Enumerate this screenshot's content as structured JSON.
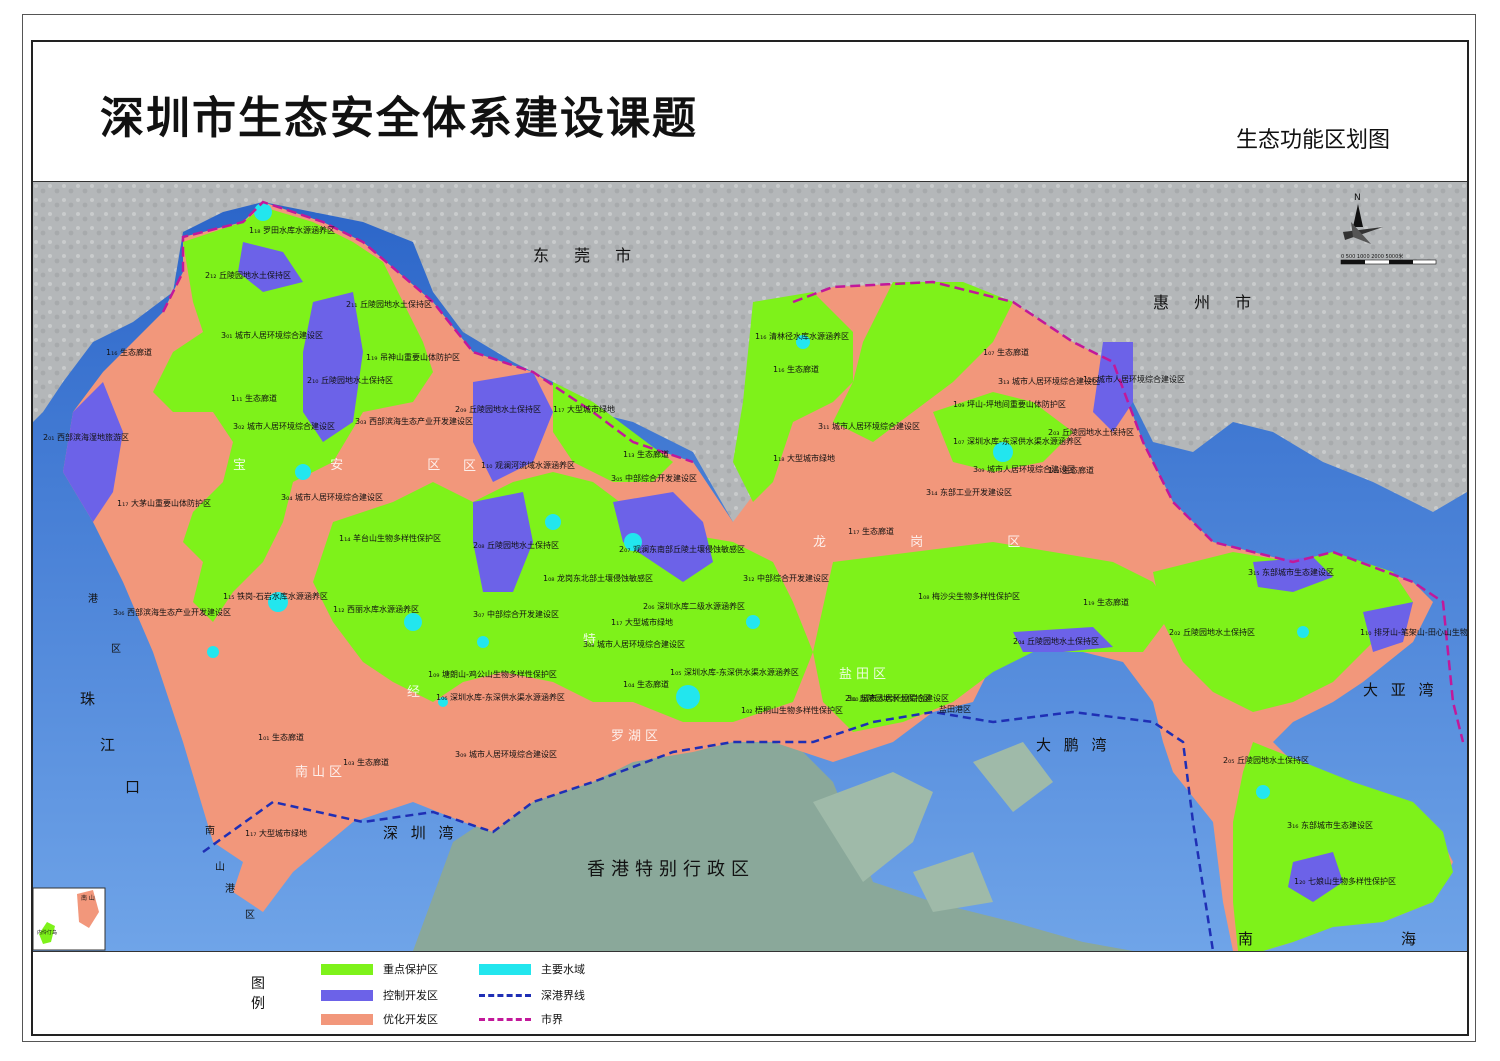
{
  "title": "深圳市生态安全体系建设课题",
  "subtitle": "生态功能区划图",
  "colors": {
    "key_protection": "#7ef21a",
    "controlled_development": "#6c62e8",
    "optimized_development": "#f2977b",
    "water": "#22e6ee",
    "sea": "#3d7fe0",
    "land_gray": "#b9bcbd",
    "hk_land": "#8aa89a",
    "sz_hk_boundary": "#1f2fb5",
    "city_boundary": "#c2189a"
  },
  "north_arrow": {
    "label": "N",
    "scale_label": "0  500  1000  2000    5000米"
  },
  "places": {
    "dongguan": "东 莞 市",
    "huizhou": "惠 州 市",
    "hongkong": "香港特别行政区",
    "shenzhen_bay": "深 圳 湾",
    "dapeng_bay": "大 鹏 湾",
    "daya_bay": "大 亚 湾",
    "south_sea_1": "南",
    "south_sea_2": "海",
    "pearl_river_mouth": [
      "珠",
      "江",
      "口"
    ],
    "nanshan_port": [
      "南",
      "山",
      "港",
      "区"
    ],
    "port_west": "港",
    "port_west_2": "区",
    "yantian_port": "盐田港区"
  },
  "districts": {
    "baoan": "宝  安  区",
    "longgang": "龙  岗  区",
    "nanshan": "南山区",
    "futian": "经",
    "futian2": "特",
    "futian3": "区",
    "luohu": "罗湖区",
    "yantian": "盐田区"
  },
  "zones": [
    "1₁₈ 罗田水库水源涵养区",
    "2₁₂ 丘陵园地水土保持区",
    "2₁₁ 丘陵园地水土保持区",
    "3₀₁ 城市人居环境综合建设区",
    "1₁₆ 生态廊道",
    "1₁₉ 吊神山重要山体防护区",
    "2₁₀ 丘陵园地水土保持区",
    "1₁₁ 生态廊道",
    "3₀₂ 城市人居环境综合建设区",
    "3₀₃ 西部滨海生态产业开发建设区",
    "2₀₁ 西部滨海湿地旅游区",
    "2₀₉ 丘陵园地水土保持区",
    "1₁₇ 大型城市绿地",
    "1₁₀ 观澜河流域水源涵养区",
    "1₁₃ 生态廊道",
    "1₁₇ 大茅山重要山体防护区",
    "3₀₄ 城市人居环境综合建设区",
    "1₁₄ 羊台山生物多样性保护区",
    "2₀₈ 丘陵园地水土保持区",
    "2₀₇ 观澜东南部丘陵土壤侵蚀敏感区",
    "3₀₅ 中部综合开发建设区",
    "1₀₈ 龙岗东北部土壤侵蚀敏感区",
    "1₁₅ 铁岗-石岩水库水源涵养区",
    "1₁₂ 西丽水库水源涵养区",
    "3₀₆ 西部滨海生态产业开发建设区",
    "3₀₇ 中部综合开发建设区",
    "1₁₇ 大型城市绿地",
    "2₀₆ 深圳水库二级水源涵养区",
    "3₀₈ 城市人居环境综合建设区",
    "1₀₉ 塘朗山-鸡公山生物多样性保护区",
    "1₀₆ 深圳水库-东深供水渠水源涵养区",
    "1₀₅ 深圳水库-东深供水渠水源涵养区",
    "1₀₄ 生态廊道",
    "1₀₂ 梧桐山生物多样性保护区",
    "1₀₁ 生态廊道",
    "1₀₃ 生态廊道",
    "3₀₉ 城市人居环境综合建设区",
    "3₁₀ 城市人居环境综合建设区",
    "1₁₇ 大型城市绿地",
    "1₁₆ 清林径水库水源涵养区",
    "1₁₆ 生态廊道",
    "1₀₇ 生态廊道",
    "1₁₈ 大型城市绿地",
    "3₁₁ 城市人居环境综合建设区",
    "1₀₇ 深圳水库-东深供水渠水源涵养区",
    "1₁₇ 生态廊道",
    "3₁₂ 中部综合开发建设区",
    "1₀₈ 梅沙尖生物多样性保护区",
    "1₀₉ 坪山-坪地间重要山体防护区",
    "3₁₃ 城市人居环境综合建设区",
    "1₁₈ 生态廊道",
    "2₀₃ 丘陵园地水土保持区",
    "3₁₄ 东部工业开发建设区",
    "1₁₉ 生态廊道",
    "3₁₅ 东部城市生态建设区",
    "2₀₄ 丘陵园地水土保持区",
    "2₀₂ 丘陵园地水土保持区",
    "1₁₀ 排牙山-笔架山-田心山生物多样性保护区",
    "2₀₅ 丘陵园地水土保持区",
    "3₁₆ 东部城市生态建设区",
    "1₂₀ 七娘山生物多样性保护区",
    "2₀₁ 丘陵园地水土保持区",
    "1₁₈ 城市人居环境综合建设区",
    "3₀₉ 城市人居环境综合建设区",
    "1₁₆ 生态廊道"
  ],
  "inset": {
    "label": "南 山",
    "island": "内伶仃岛"
  },
  "legend": {
    "title": "图\n例",
    "key_protection": "重点保护区",
    "controlled_development": "控制开发区",
    "optimized_development": "优化开发区",
    "water": "主要水域",
    "sz_hk_boundary": "深港界线",
    "city_boundary": "市界"
  }
}
